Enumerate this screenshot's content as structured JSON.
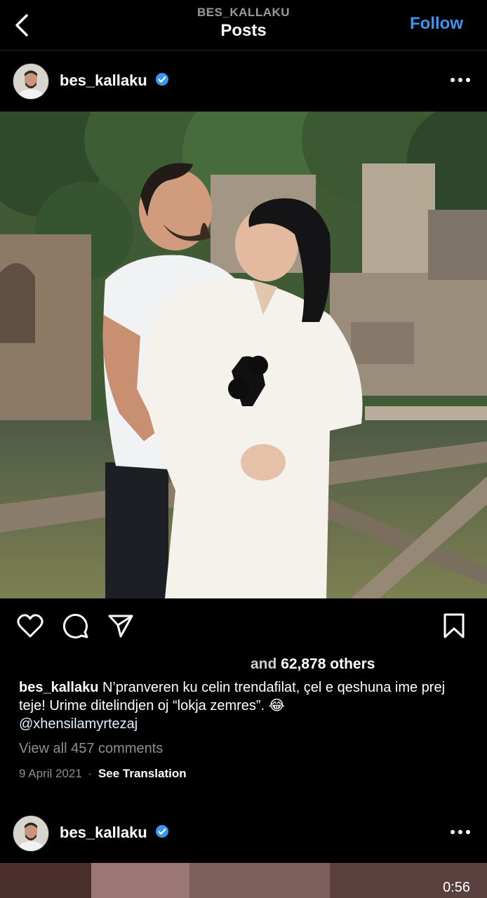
{
  "header": {
    "subtitle": "BES_KALLAKU",
    "title": "Posts",
    "follow_label": "Follow"
  },
  "post": {
    "username": "bes_kallaku",
    "likes_prefix": "and",
    "likes_text": "62,878 others",
    "caption_user": "bes_kallaku",
    "caption_text": "N’pranveren ku celin trendafilat, çel e qeshuna ime prej teje! Urime ditelindjen oj “lokja zemres”. 😂",
    "caption_mention": "@xhensilamyrtezaj",
    "view_comments": "View all 457 comments",
    "date": "9 April 2021",
    "separator": "·",
    "see_translation": "See Translation"
  },
  "next_post": {
    "username": "bes_kallaku",
    "video_duration": "0:56"
  },
  "icons": [
    "back-icon",
    "verified-icon",
    "more-icon",
    "heart-icon",
    "comment-icon",
    "share-icon",
    "bookmark-icon"
  ],
  "colors": {
    "accent": "#3897f0",
    "verified": "#3897f0",
    "muted": "#8e8e8e"
  }
}
